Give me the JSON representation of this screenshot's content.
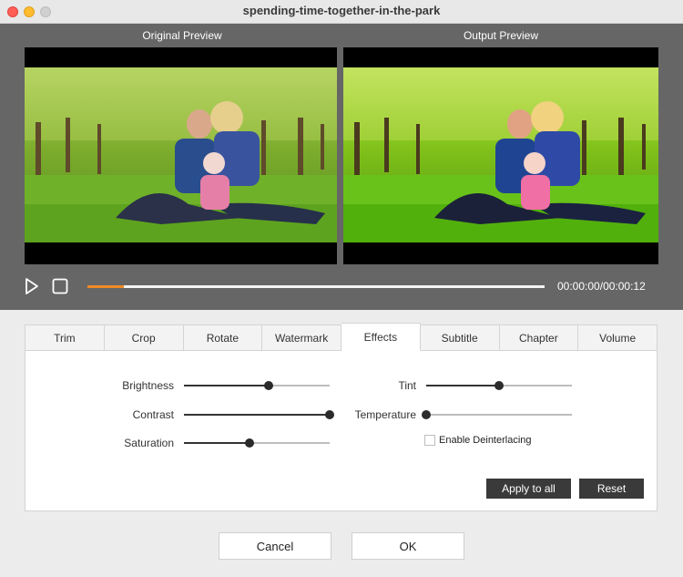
{
  "window": {
    "title": "spending-time-together-in-the-park"
  },
  "preview": {
    "original_label": "Original Preview",
    "output_label": "Output Preview",
    "time_current": "00:00:00",
    "time_separator": "/",
    "time_total": "00:00:12",
    "progress_fraction": 0.08
  },
  "tabs": [
    {
      "label": "Trim"
    },
    {
      "label": "Crop"
    },
    {
      "label": "Rotate"
    },
    {
      "label": "Watermark"
    },
    {
      "label": "Effects",
      "active": true
    },
    {
      "label": "Subtitle"
    },
    {
      "label": "Chapter"
    },
    {
      "label": "Volume"
    }
  ],
  "effects": {
    "brightness": {
      "label": "Brightness",
      "value": 0.58
    },
    "contrast": {
      "label": "Contrast",
      "value": 1.0
    },
    "saturation": {
      "label": "Saturation",
      "value": 0.45
    },
    "tint": {
      "label": "Tint",
      "value": 0.5
    },
    "temperature": {
      "label": "Temperature",
      "value": 0.0
    },
    "deinterlace": {
      "label": "Enable Deinterlacing",
      "checked": false
    }
  },
  "buttons": {
    "apply_all": "Apply to all",
    "reset": "Reset",
    "cancel": "Cancel",
    "ok": "OK"
  },
  "colors": {
    "accent_progress": "#f08a24",
    "preview_bg": "#666666",
    "dark_button": "#3a3a3a"
  }
}
